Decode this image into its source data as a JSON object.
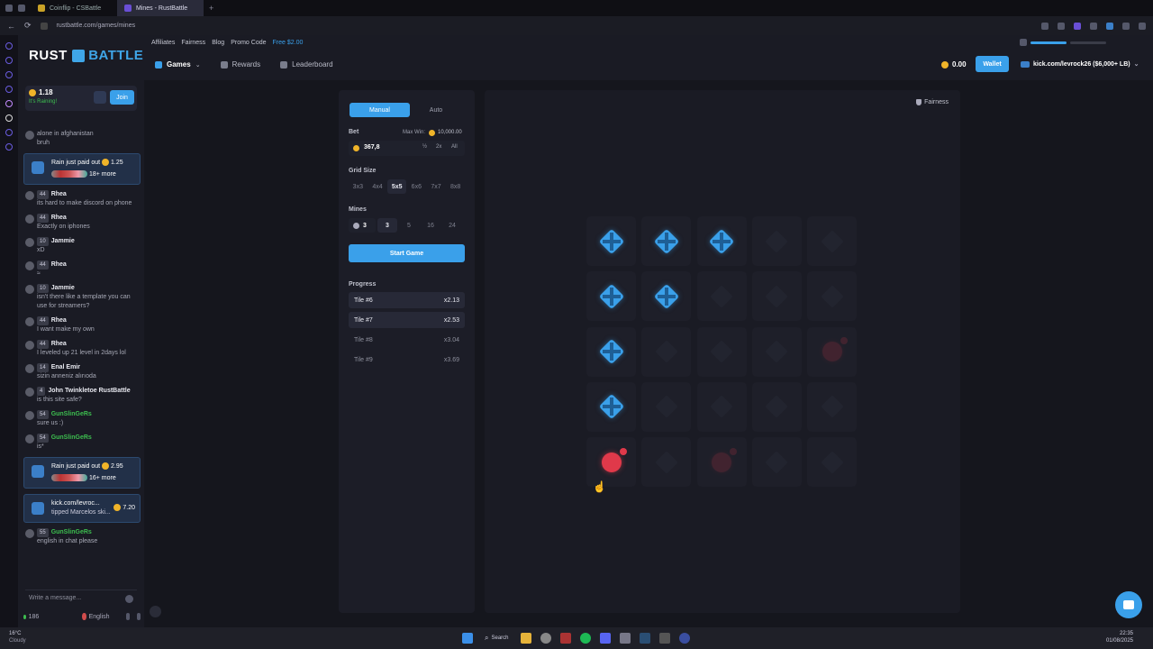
{
  "browser": {
    "tabs": [
      {
        "title": "Coinflip - CSBattle",
        "active": false
      },
      {
        "title": "Mines - RustBattle",
        "active": true
      }
    ],
    "url": "rustbattle.com/games/mines"
  },
  "site": {
    "logo_left": "RUST",
    "logo_right": "BATTLE",
    "top_links": [
      "Affiliates",
      "Fairness",
      "Blog",
      "Promo Code"
    ],
    "free_link": "Free $2.00",
    "nav": [
      {
        "label": "Games",
        "icon": "gamepad-icon"
      },
      {
        "label": "Rewards",
        "icon": "gift-icon"
      },
      {
        "label": "Leaderboard",
        "icon": "trophy-icon"
      }
    ],
    "balance": "0.00",
    "wallet_label": "Wallet",
    "user": "kick.com/levrock26 ($6,000+ LB)"
  },
  "rain": {
    "amount": "1.18",
    "label": "It's Raining!",
    "join": "Join"
  },
  "chat": {
    "messages": [
      {
        "type": "msg",
        "level": "",
        "user": "",
        "text": "alone in afghanistan",
        "extra": "bruh"
      },
      {
        "type": "rain",
        "title": "Rain just paid out",
        "amount": "1.25",
        "more": "18+ more"
      },
      {
        "type": "msg",
        "level": "44",
        "user": "Rhea",
        "text": "its hard to make discord on phone"
      },
      {
        "type": "msg",
        "level": "44",
        "user": "Rhea",
        "text": "Exactly on iphones"
      },
      {
        "type": "msg",
        "level": "10",
        "user": "Jammie",
        "text": "xD"
      },
      {
        "type": "msg",
        "level": "44",
        "user": "Rhea",
        "text": "≈"
      },
      {
        "type": "msg",
        "level": "10",
        "user": "Jammie",
        "text": "isn't there like a template you can use for streamers?"
      },
      {
        "type": "msg",
        "level": "44",
        "user": "Rhea",
        "text": "I want make my own"
      },
      {
        "type": "msg",
        "level": "44",
        "user": "Rhea",
        "text": "I leveled up 21 level in 2days lol"
      },
      {
        "type": "msg",
        "level": "14",
        "user": "Enal Emir",
        "text": "sizin anneniz alırıoda"
      },
      {
        "type": "msg",
        "level": "4",
        "user": "John Twinkletoe RustBattle",
        "text": "is this site safe?"
      },
      {
        "type": "msg",
        "level": "54",
        "user": "GunSlinGeRs",
        "text": "sure us :)",
        "green": true
      },
      {
        "type": "msg",
        "level": "54",
        "user": "GunSlinGeRs",
        "text": "is*",
        "green": true
      },
      {
        "type": "rain",
        "title": "Rain just paid out",
        "amount": "2.95",
        "more": "16+ more"
      },
      {
        "type": "tip",
        "title": "kick.com/levroc...",
        "sub": "tipped Marcelos ski...",
        "amount": "7.20"
      },
      {
        "type": "msg",
        "level": "55",
        "user": "GunSlinGeRs",
        "text": "english in chat please",
        "green": true
      }
    ],
    "input_placeholder": "Write a message...",
    "online": "186",
    "language": "English"
  },
  "controls": {
    "mode_manual": "Manual",
    "mode_auto": "Auto",
    "bet_label": "Bet",
    "max_win_label": "Max Win:",
    "max_win": "10,000.00",
    "bet_value": "367,8",
    "bet_half": "½",
    "bet_double": "2x",
    "bet_all": "All",
    "grid_label": "Grid Size",
    "grid_options": [
      "3x3",
      "4x4",
      "5x5",
      "6x6",
      "7x7",
      "8x8"
    ],
    "grid_selected": "5x5",
    "mines_label": "Mines",
    "mines_value": "3",
    "mines_options": [
      "3",
      "5",
      "16",
      "24"
    ],
    "mines_selected": "3",
    "start_label": "Start Game",
    "progress_label": "Progress",
    "progress": [
      {
        "tile": "Tile #6",
        "mult": "x2.13",
        "done": true
      },
      {
        "tile": "Tile #7",
        "mult": "x2.53",
        "done": true
      },
      {
        "tile": "Tile #8",
        "mult": "x3.04",
        "done": false
      },
      {
        "tile": "Tile #9",
        "mult": "x3.69",
        "done": false
      }
    ]
  },
  "game": {
    "fairness_label": "Fairness",
    "grid": [
      [
        "gem",
        "gem",
        "gem",
        "empty",
        "empty"
      ],
      [
        "gem",
        "gem",
        "empty",
        "empty",
        "empty"
      ],
      [
        "gem",
        "empty",
        "empty",
        "empty",
        "bomb-faded"
      ],
      [
        "gem",
        "empty",
        "empty",
        "empty",
        "empty"
      ],
      [
        "bomb",
        "empty",
        "bomb-faded",
        "empty",
        "empty"
      ]
    ]
  },
  "taskbar": {
    "weather_temp": "16°C",
    "weather_text": "Cloudy",
    "search": "Search",
    "time": "22:35",
    "date": "01/08/2025"
  },
  "colors": {
    "accent": "#3aa0ea",
    "bomb": "#e0394a",
    "coin": "#f0b429",
    "green_name": "#3dbd4f"
  }
}
